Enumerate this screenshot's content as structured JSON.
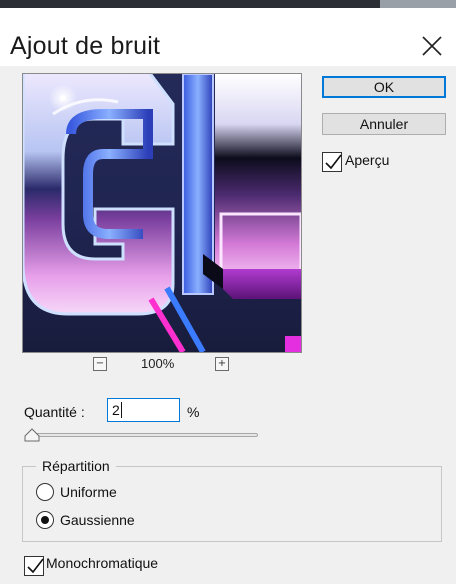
{
  "dialog": {
    "title": "Ajout de bruit"
  },
  "preview": {
    "zoom_out": "−",
    "zoom_level": "100%",
    "zoom_in": "+"
  },
  "buttons": {
    "ok": "OK",
    "cancel": "Annuler"
  },
  "preview_toggle": {
    "label": "Aperçu",
    "checked": true
  },
  "amount": {
    "label": "Quantité :",
    "value": "2",
    "unit": "%",
    "slider_fraction": 0.02
  },
  "distribution": {
    "title": "Répartition",
    "options": [
      {
        "label": "Uniforme",
        "selected": false
      },
      {
        "label": "Gaussienne",
        "selected": true
      }
    ]
  },
  "monochrome": {
    "label": "Monochromatique",
    "checked": true
  },
  "colors": {
    "accent": "#0078d7",
    "window_bg": "#f0f0f0",
    "title_bg": "#ffffff"
  }
}
